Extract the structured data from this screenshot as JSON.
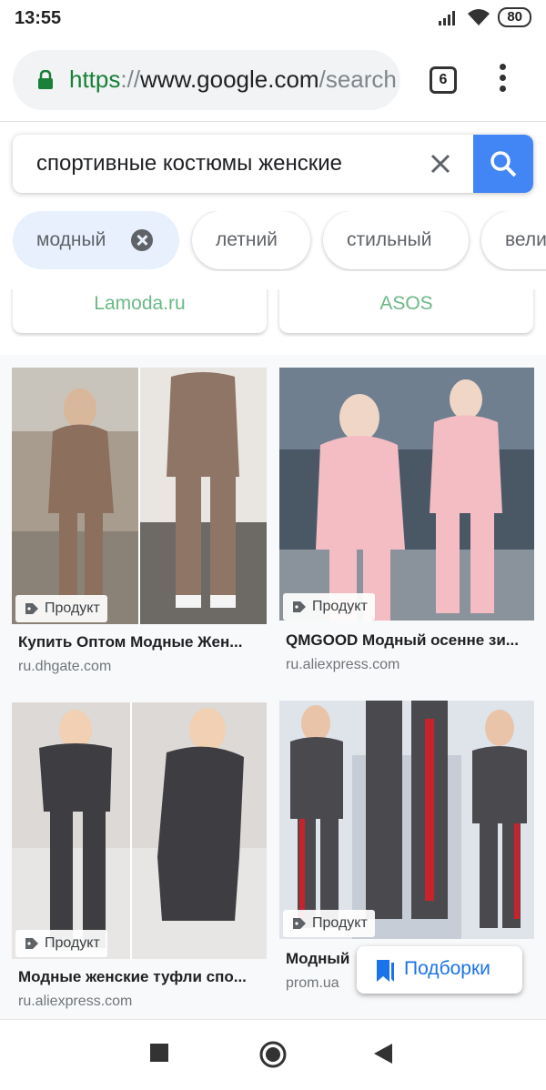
{
  "status_bar": {
    "time": "13:55",
    "battery": "80"
  },
  "browser": {
    "url_scheme": "https",
    "url_sep": "://",
    "url_host": "www.google.com",
    "url_rest": "/search?q=спортивные",
    "tab_count": "6"
  },
  "search": {
    "query": "спортивные костюмы женские"
  },
  "chips": [
    {
      "label": "модный",
      "selected": true
    },
    {
      "label": "летний",
      "selected": false
    },
    {
      "label": "стильный",
      "selected": false
    },
    {
      "label": "вели",
      "selected": false
    }
  ],
  "stores": [
    "Lamoda.ru",
    "ASOS"
  ],
  "results": [
    {
      "badge": "Продукт",
      "title": "Купить Оптом Модные Жен...",
      "source": "ru.dhgate.com"
    },
    {
      "badge": "Продукт",
      "title": "QMGOOD Модный осенне зи...",
      "source": "ru.aliexpress.com"
    },
    {
      "badge": "Продукт",
      "title": "Модные женские туфли спо...",
      "source": "ru.aliexpress.com"
    },
    {
      "badge": "Продукт",
      "title": "Модный",
      "source": "prom.ua"
    }
  ],
  "collections_button": {
    "label": "Подборки"
  },
  "colors": {
    "accent": "#4285f4",
    "link": "#1a73e8",
    "chip_selected": "#e8f0fe",
    "store_text": "#6ab985"
  }
}
